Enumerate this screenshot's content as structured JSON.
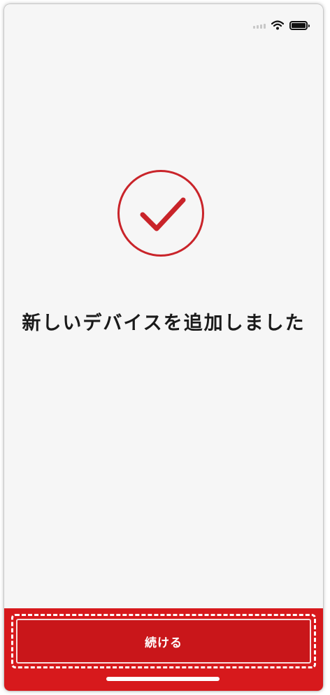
{
  "status_bar": {
    "signal_icon": "cellular-signal-icon",
    "wifi_icon": "wifi-icon",
    "battery_icon": "battery-icon",
    "battery_level": 1.0
  },
  "success": {
    "icon": "checkmark-icon",
    "accent_color": "#c9242a",
    "title": "新しいデバイスを追加しました"
  },
  "footer": {
    "continue_label": "続ける",
    "background_color": "#d7191c"
  }
}
